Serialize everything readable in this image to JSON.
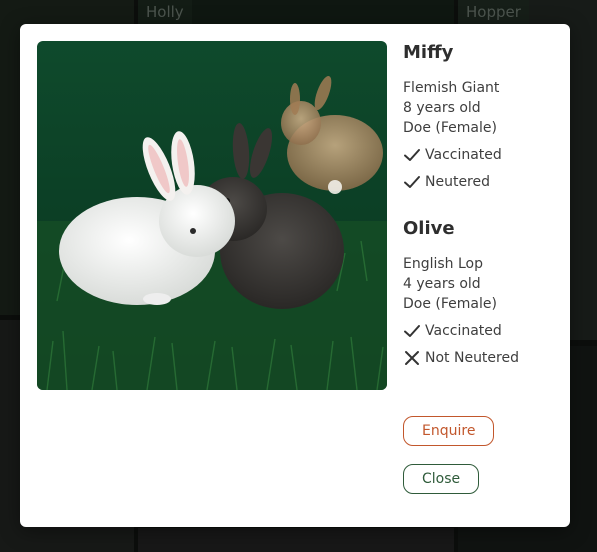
{
  "background": {
    "tile_labels": [
      "Holly",
      "Hopper"
    ]
  },
  "modal": {
    "photo_alt": "rabbits-photo",
    "pets": [
      {
        "name": "Miffy",
        "breed": "Flemish Giant",
        "age": "8 years old",
        "sex": "Doe (Female)",
        "status1": {
          "icon": "check-icon",
          "label": "Vaccinated"
        },
        "status2": {
          "icon": "check-icon",
          "label": "Neutered"
        }
      },
      {
        "name": "Olive",
        "breed": "English Lop",
        "age": "4 years old",
        "sex": "Doe (Female)",
        "status1": {
          "icon": "check-icon",
          "label": "Vaccinated"
        },
        "status2": {
          "icon": "cross-icon",
          "label": "Not Neutered"
        }
      }
    ],
    "buttons": {
      "enquire": "Enquire",
      "close": "Close"
    }
  },
  "colors": {
    "enquire_accent": "#c2572c",
    "close_accent": "#2f5b3a"
  }
}
